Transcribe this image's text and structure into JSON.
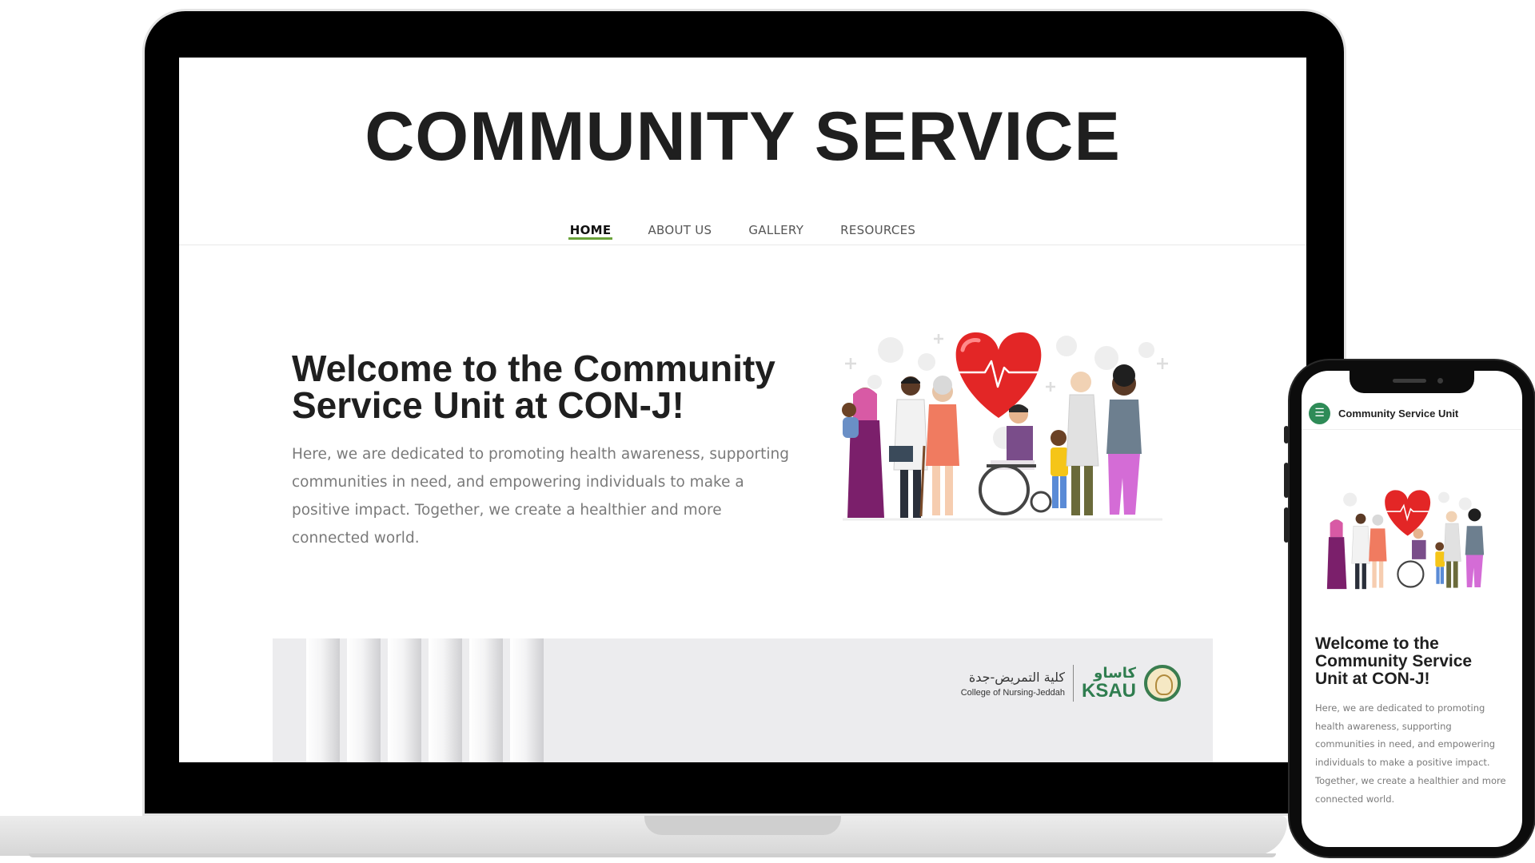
{
  "laptop": {
    "site_title": "COMMUNITY SERVICE",
    "nav": {
      "items": [
        {
          "label": "HOME"
        },
        {
          "label": "ABOUT US"
        },
        {
          "label": "GALLERY"
        },
        {
          "label": "RESOURCES"
        }
      ],
      "active_index": 0,
      "active_color": "#6aa33a"
    },
    "hero": {
      "heading": "Welcome to the Community Service Unit at CON-J!",
      "text": "Here, we are dedicated to promoting health awareness, supporting communities in need, and empowering individuals to make a positive impact. Together, we create a healthier and more connected world.",
      "illustration": "community-people-heart-illustration"
    },
    "banner": {
      "logo_arabic": "كلية التمريض-جدة",
      "logo_english": "College of Nursing-Jeddah",
      "logo_brand_arabic": "كاساو",
      "logo_brand": "KSAU",
      "brand_color": "#2f7d4f"
    }
  },
  "phone": {
    "menu_icon": "hamburger-menu-icon",
    "brand": "Community Service Unit",
    "heading": "Welcome to the Community Service Unit at CON-J!",
    "text": "Here, we are dedicated to promoting health awareness, supporting communities in need, and empowering individuals to make a positive impact. Together, we create a healthier and more connected world.",
    "accent_color": "#2e8b57"
  }
}
